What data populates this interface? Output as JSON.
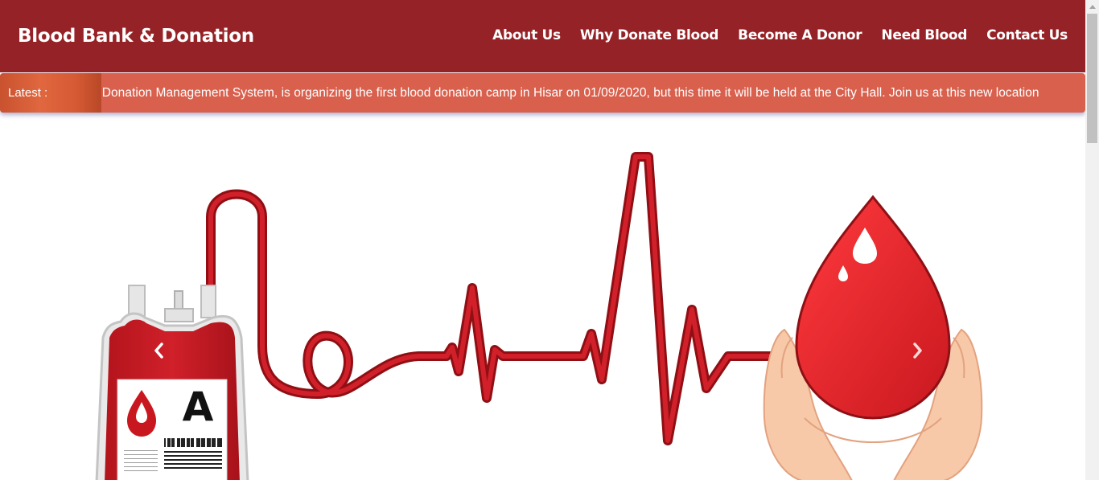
{
  "brand": "Blood Bank & Donation",
  "nav": {
    "about": "About Us",
    "why": "Why Donate Blood",
    "become": "Become A Donor",
    "need": "Need Blood",
    "contact": "Contact Us"
  },
  "ticker": {
    "label": "Latest :",
    "text": "& Donation Management System, is organizing the first blood donation camp in Hisar on 01/09/2020, but this time it will be held at the City Hall. Join us at this new location"
  },
  "bag": {
    "blood_type": "A"
  },
  "carousel": {
    "prev_icon": "chevron-left-icon",
    "next_icon": "chevron-right-icon"
  },
  "colors": {
    "navbar": "#952226",
    "ticker": "#d9604d",
    "blood_red": "#c8171e"
  }
}
